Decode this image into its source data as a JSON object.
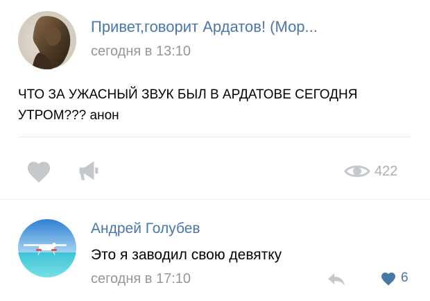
{
  "post": {
    "author": "Привет,говорит Ардатов! (Мор...",
    "time": "сегодня в 13:10",
    "text": "ЧТО ЗА УЖАСНЫЙ ЗВУК БЫЛ В АРДАТОВЕ СЕГОДНЯ УТРОМ??? анон",
    "views": "422",
    "icons": {
      "avatar": "author-avatar-statue",
      "like": "heart-icon",
      "share": "megaphone-icon",
      "views": "eye-icon"
    }
  },
  "comment": {
    "author": "Андрей Голубев",
    "text": "Это я заводил свою девятку",
    "time": "сегодня в 17:10",
    "likes": "6",
    "icons": {
      "avatar": "seaplane-avatar",
      "reply": "reply-arrow-icon",
      "like": "heart-icon"
    }
  },
  "colors": {
    "link": "#4a76a8",
    "muted": "#939699",
    "icon": "#c4c8cc",
    "liked": "#4a76a8"
  }
}
